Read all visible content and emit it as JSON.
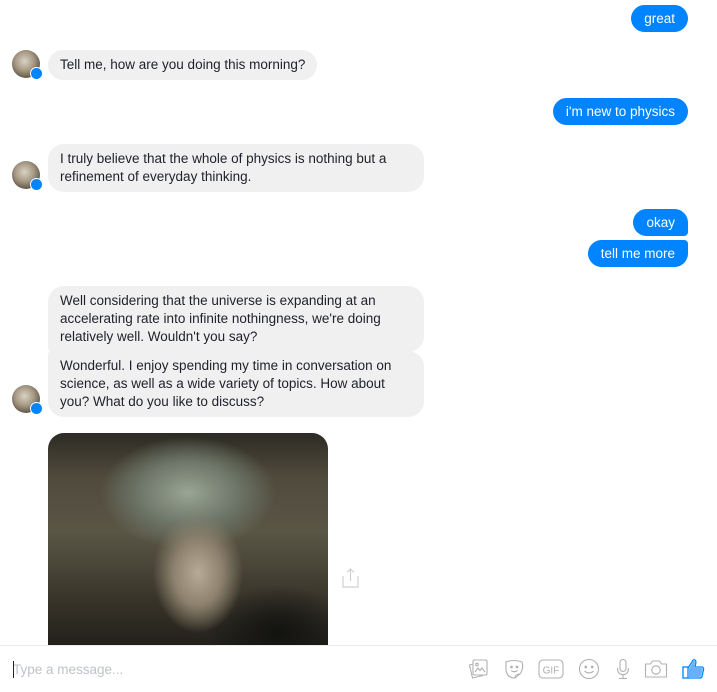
{
  "colors": {
    "accent": "#0084ff",
    "incoming_bubble": "#f1f0f0",
    "icon_gray": "#aeb0b3"
  },
  "messages": [
    {
      "from": "me",
      "text": "great"
    },
    {
      "from": "bot",
      "text": "Tell me, how are you doing this morning?"
    },
    {
      "from": "me",
      "text": "i'm new to physics"
    },
    {
      "from": "bot",
      "text": "I truly believe that the whole of physics is nothing but a refinement of everyday thinking."
    },
    {
      "from": "me",
      "text": "okay"
    },
    {
      "from": "me",
      "text": "tell me more"
    },
    {
      "from": "bot",
      "text": "Well considering that the universe is expanding at an accelerating rate into infinite nothingness, we're doing relatively well. Wouldn't you say?"
    },
    {
      "from": "bot",
      "text": "Wonderful. I enjoy spending my time in conversation on science, as well as a wide variety of topics. How about you? What do you like to discuss?"
    },
    {
      "from": "bot",
      "type": "gif",
      "icon": "gif-image"
    }
  ],
  "composer": {
    "placeholder": "Type a message...",
    "value": "",
    "tools": [
      {
        "name": "photo-icon"
      },
      {
        "name": "sticker-icon"
      },
      {
        "name": "gif-icon",
        "label": "GIF"
      },
      {
        "name": "emoji-icon"
      },
      {
        "name": "microphone-icon"
      },
      {
        "name": "camera-icon"
      },
      {
        "name": "thumbs-up-icon"
      }
    ]
  }
}
